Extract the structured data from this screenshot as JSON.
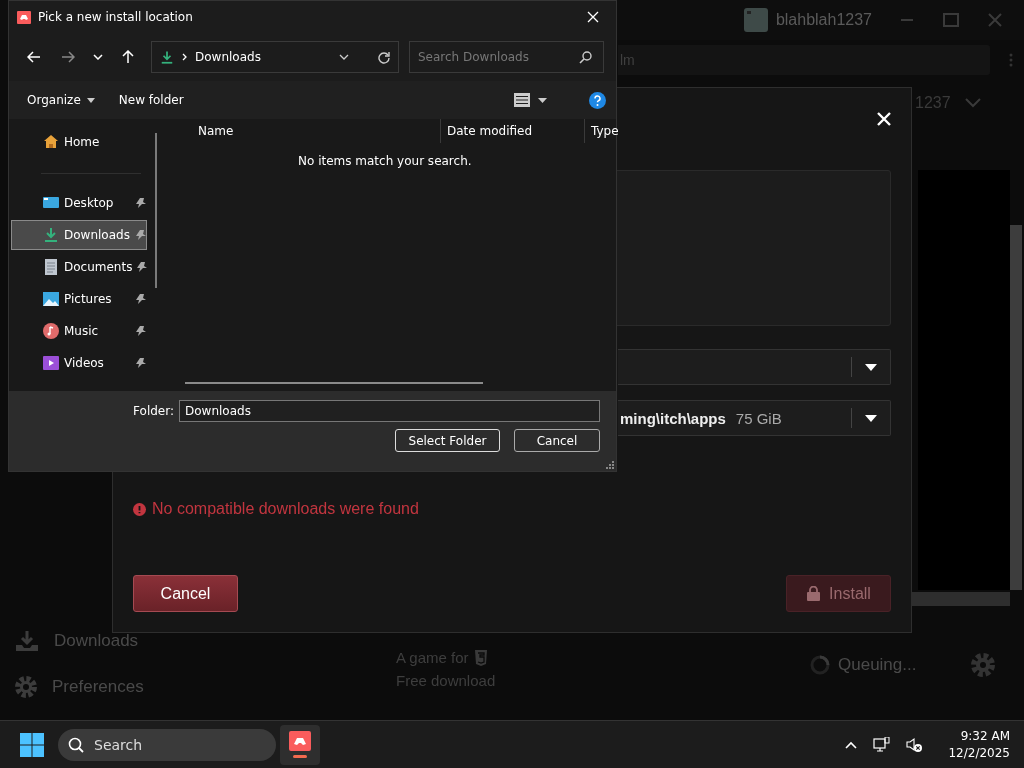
{
  "app_window": {
    "username": "blahblah1237",
    "search_text": "lm",
    "account_text": "1237",
    "sidebar_items": [
      {
        "label": "Downloads",
        "kind": "downloads"
      },
      {
        "label": "Preferences",
        "kind": "preferences"
      }
    ],
    "game": {
      "platform_text": "A game for",
      "price": "Free download"
    },
    "download_status": "Queuing..."
  },
  "install_modal": {
    "location_path": "ming\\itch\\apps",
    "free_space": "75 GiB",
    "error": "No compatible downloads were found",
    "buttons": [
      {
        "label": "Cancel",
        "disabled": false
      },
      {
        "label": "Install",
        "disabled": true
      }
    ]
  },
  "file_dialog": {
    "title": "Pick a new install location",
    "breadcrumb": "Downloads",
    "search": {
      "placeholder": "Search Downloads"
    },
    "toolbar": [
      "Organize",
      "New folder"
    ],
    "sidebar": {
      "items": [
        {
          "label": "Home",
          "kind": "home",
          "pinned": false,
          "selected": false
        },
        {
          "label": "Desktop",
          "kind": "desktop",
          "pinned": true,
          "selected": false
        },
        {
          "label": "Downloads",
          "kind": "downloads",
          "pinned": true,
          "selected": true
        },
        {
          "label": "Documents",
          "kind": "documents",
          "pinned": true,
          "selected": false
        },
        {
          "label": "Pictures",
          "kind": "pictures",
          "pinned": true,
          "selected": false
        },
        {
          "label": "Music",
          "kind": "music",
          "pinned": true,
          "selected": false
        },
        {
          "label": "Videos",
          "kind": "videos",
          "pinned": true,
          "selected": false
        }
      ]
    },
    "columns": [
      "Name",
      "Date modified",
      "Type"
    ],
    "empty_message": "No items match your search.",
    "folder_label": "Folder:",
    "folder_value": "Downloads",
    "buttons": [
      "Select Folder",
      "Cancel"
    ]
  },
  "taskbar": {
    "search_placeholder": "Search",
    "time": "9:32 AM",
    "date": "12/2/2025"
  }
}
